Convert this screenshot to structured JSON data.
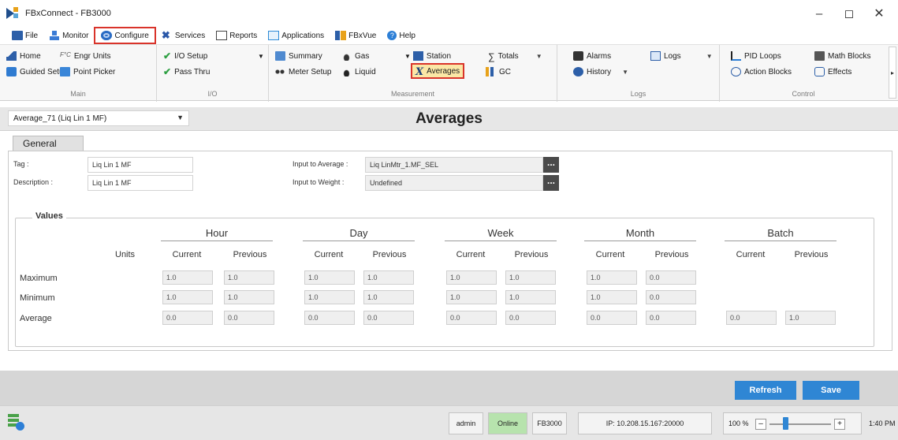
{
  "window": {
    "title": "FBxConnect - FB3000"
  },
  "menu": [
    {
      "label": "File",
      "icon": "folder-icon"
    },
    {
      "label": "Monitor",
      "icon": "monitor-icon"
    },
    {
      "label": "Configure",
      "icon": "gear-icon",
      "active": true
    },
    {
      "label": "Services",
      "icon": "tools-icon"
    },
    {
      "label": "Reports",
      "icon": "report-icon"
    },
    {
      "label": "Applications",
      "icon": "applications-icon"
    },
    {
      "label": "FBxVue",
      "icon": "fbxvue-icon"
    },
    {
      "label": "Help",
      "icon": "help-icon"
    }
  ],
  "ribbon": {
    "main": {
      "label": "Main",
      "home": "Home",
      "engr_units": "Engr Units",
      "guided_setup": "Guided Setup",
      "point_picker": "Point Picker"
    },
    "io": {
      "label": "I/O",
      "io_setup": "I/O Setup",
      "pass_thru": "Pass Thru"
    },
    "measurement": {
      "label": "Measurement",
      "summary": "Summary",
      "meter_setup": "Meter Setup",
      "gas": "Gas",
      "liquid": "Liquid",
      "station": "Station",
      "averages": "Averages",
      "totals": "Totals",
      "gc": "GC"
    },
    "logs": {
      "label": "Logs",
      "alarms": "Alarms",
      "history": "History",
      "logs": "Logs"
    },
    "control": {
      "label": "Control",
      "pid_loops": "PID Loops",
      "action_blocks": "Action Blocks",
      "math_blocks": "Math Blocks",
      "effects": "Effects"
    }
  },
  "header": {
    "point_selected": "Average_71 (Liq Lin 1 MF)",
    "page_title": "Averages"
  },
  "tab": {
    "label": "General"
  },
  "form": {
    "tag_label": "Tag :",
    "tag_value": "Liq Lin 1 MF",
    "description_label": "Description :",
    "description_value": "Liq Lin 1 MF",
    "input_to_average_label": "Input to Average :",
    "input_to_average_value": "Liq LinMtr_1.MF_SEL",
    "input_to_weight_label": "Input to Weight :",
    "input_to_weight_value": "Undefined",
    "browse_label": "..."
  },
  "values": {
    "legend": "Values",
    "units_label": "Units",
    "groups": [
      "Hour",
      "Day",
      "Week",
      "Month",
      "Batch"
    ],
    "current_label": "Current",
    "previous_label": "Previous",
    "rows": [
      {
        "label": "Maximum",
        "cells": [
          "1.0",
          "1.0",
          "1.0",
          "1.0",
          "1.0",
          "1.0",
          "1.0",
          "0.0"
        ]
      },
      {
        "label": "Minimum",
        "cells": [
          "1.0",
          "1.0",
          "1.0",
          "1.0",
          "1.0",
          "1.0",
          "1.0",
          "0.0"
        ]
      },
      {
        "label": "Average",
        "cells": [
          "0.0",
          "0.0",
          "0.0",
          "0.0",
          "0.0",
          "0.0",
          "0.0",
          "0.0",
          "0.0",
          "1.0"
        ]
      }
    ]
  },
  "actions": {
    "refresh": "Refresh",
    "save": "Save"
  },
  "status": {
    "user": "admin",
    "connection": "Online",
    "device": "FB3000",
    "ip": "IP: 10.208.15.167:20000",
    "zoom": "100 %",
    "time": "1:40 PM"
  },
  "colors": {
    "accent": "#2f86d4",
    "highlight_border": "#d9342b",
    "online": "#b7e3ad"
  }
}
